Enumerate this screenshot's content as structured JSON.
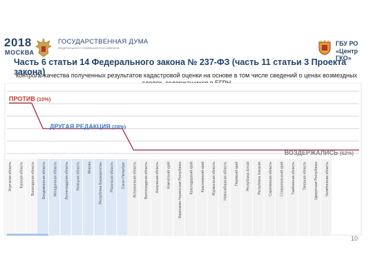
{
  "header": {
    "year": "2018",
    "city": "МОСКВА",
    "duma_title": "ГОСУДАРСТВЕННАЯ ДУМА",
    "duma_subtitle": "ФЕДЕРАЛЬНОГО СОБРАНИЯ РОССИЙСКОЙ",
    "org_line1": "ГБУ РО",
    "org_line2": "«Центр ГКО»",
    "emblem_icon": "double-headed-eagle-icon",
    "org_icon": "coat-of-arms-icon"
  },
  "title": "Часть 6 статьи 14 Федерального закона № 237-ФЗ (часть 11 статьи 3 Проекта закона)",
  "subtitle": "контроль качества полученных результатов кадастровой оценки на основе в том числе сведений о ценах возмездных сделок, содержащихся в ЕГРН",
  "page_number": "10",
  "chart_data": {
    "type": "line",
    "levels": [
      {
        "key": "against",
        "label": "ПРОТИВ",
        "value_label": "(10%)",
        "color": "#c0392b"
      },
      {
        "key": "other",
        "label": "ДРУГАЯ РЕДАКЦИЯ",
        "value_label": "(28%)",
        "color": "#3f78c8"
      },
      {
        "key": "abstain",
        "label": "ВОЗДЕРЖАЛИСЬ",
        "value_label": "(62%)",
        "color": "#7f7f7f"
      }
    ],
    "series_color": "#a02040",
    "groups": [
      {
        "key": "against",
        "color": "#f6f6f6",
        "regions": [
          "Журчатая область",
          "Курская область",
          "Вологодская область"
        ]
      },
      {
        "key": "other",
        "color": "#dde8f6",
        "regions": [
          "Владимирская область",
          "Магаданская область",
          "Ленинградская область",
          "Липецкая область",
          "Москва",
          "Республика Башкортостан",
          "Рязанская область",
          "Санкт-Петербург"
        ]
      },
      {
        "key": "abstain",
        "color": "#f2f2f2",
        "regions": [
          "Астраханская область",
          "Волгоградская область",
          "Калужская область",
          "Камчатский край",
          "Карачаево-Черкесская Республика",
          "Краснодарский край",
          "Красноярский край",
          "Мурманская область",
          "Новосибирская область",
          "Пермский край",
          "Республика Алтай",
          "Республика Хакасия",
          "Саратовская область",
          "Ставропольский край",
          "Тамбовская область",
          "Тверская область",
          "Удмуртская Республика",
          "Челябинская область"
        ]
      }
    ]
  }
}
